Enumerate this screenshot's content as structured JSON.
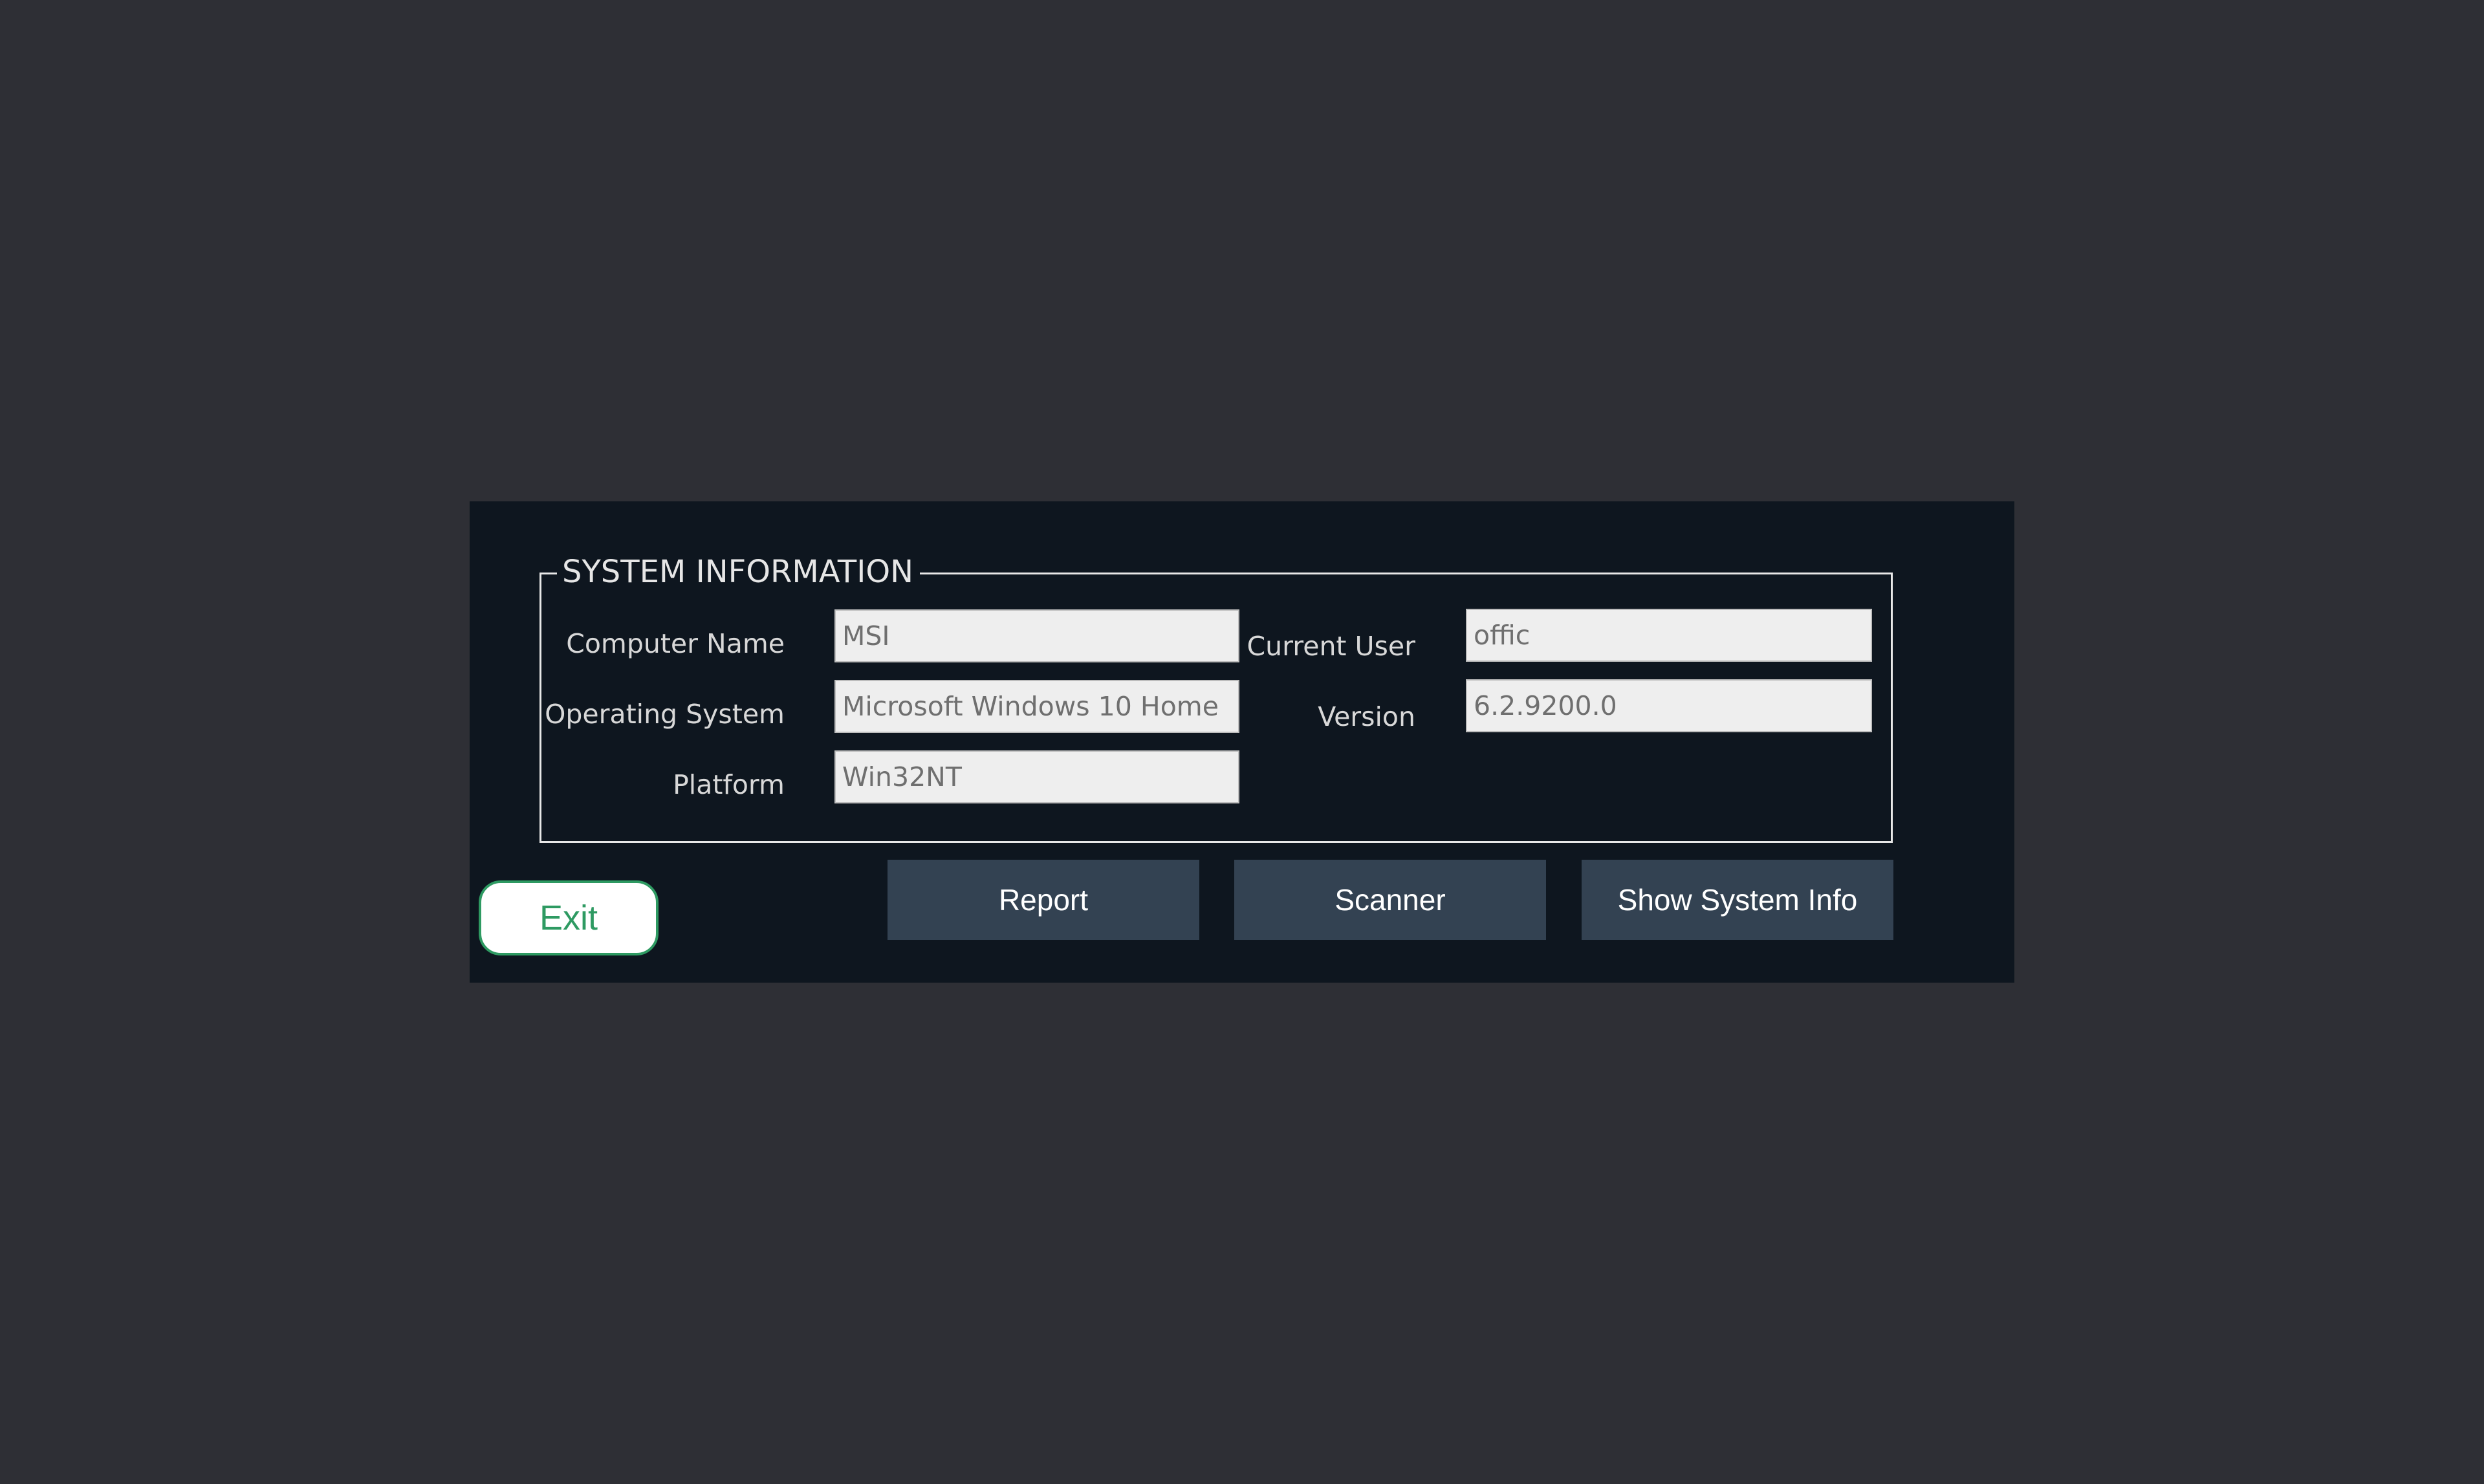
{
  "group": {
    "title": "SYSTEM INFORMATION"
  },
  "fields": {
    "computer_name": {
      "label": "Computer Name",
      "value": "MSI"
    },
    "operating_system": {
      "label": "Operating System",
      "value": "Microsoft Windows 10 Home"
    },
    "platform": {
      "label": "Platform",
      "value": "Win32NT"
    },
    "current_user": {
      "label": "Current User",
      "value": "offic"
    },
    "version": {
      "label": "Version",
      "value": "6.2.9200.0"
    }
  },
  "buttons": {
    "exit": "Exit",
    "report": "Report",
    "scanner": "Scanner",
    "show_system_info": "Show System Info"
  },
  "colors": {
    "background": "#2e2f35",
    "window": "#0e161f",
    "button": "#334252",
    "exit_accent": "#2e9a62"
  }
}
